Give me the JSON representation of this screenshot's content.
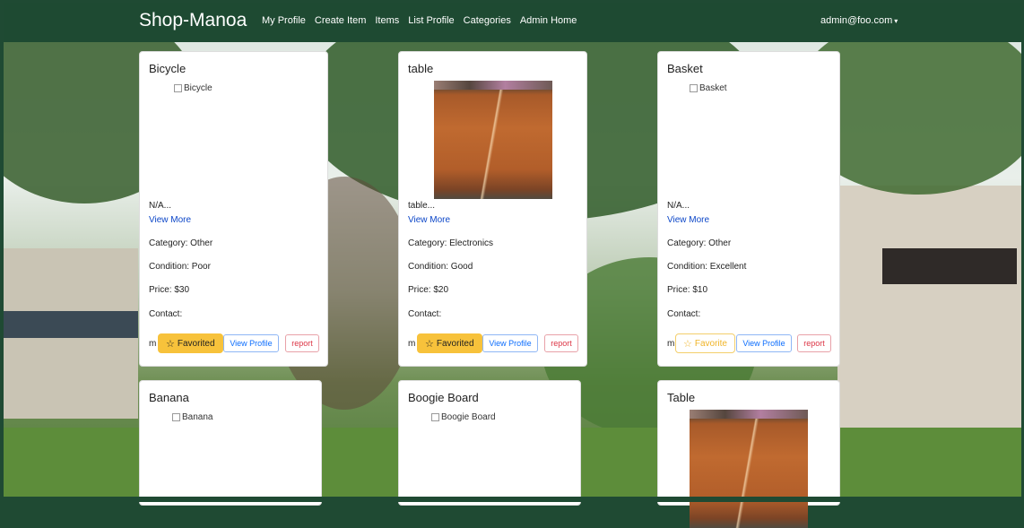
{
  "navbar": {
    "brand": "Shop-Manoa",
    "links": [
      "My Profile",
      "Create Item",
      "Items",
      "List Profile",
      "Categories",
      "Admin Home"
    ],
    "user": "admin@foo.com",
    "user_caret": "▾"
  },
  "colors": {
    "navbar": "#1e4a32",
    "favorite": "#f7c23b",
    "link": "#0d47c8",
    "report": "#dc3545",
    "view_profile": "#0d6efd"
  },
  "cards": [
    {
      "title": "Bicycle",
      "image_alt": "Bicycle",
      "description": "N/A...",
      "view_more": "View More",
      "category": "Category: Other",
      "condition": "Condition: Poor",
      "price": "Price: $30",
      "contact": "Contact:",
      "contact_initial": "m",
      "favorite_label": "Favorited",
      "favorited": true,
      "view_profile": "View Profile",
      "report": "report"
    },
    {
      "title": "table",
      "image_alt": "",
      "description": "table...",
      "view_more": "View More",
      "category": "Category: Electronics",
      "condition": "Condition: Good",
      "price": "Price: $20",
      "contact": "Contact:",
      "contact_initial": "m",
      "favorite_label": "Favorited",
      "favorited": true,
      "view_profile": "View Profile",
      "report": "report"
    },
    {
      "title": "Basket",
      "image_alt": "Basket",
      "description": "N/A...",
      "view_more": "View More",
      "category": "Category: Other",
      "condition": "Condition: Excellent",
      "price": "Price: $10",
      "contact": "Contact:",
      "contact_initial": "m",
      "favorite_label": "Favorite",
      "favorited": false,
      "view_profile": "View Profile",
      "report": "report"
    },
    {
      "title": "Banana",
      "image_alt": "Banana"
    },
    {
      "title": "Boogie Board",
      "image_alt": "Boogie Board"
    },
    {
      "title": "Table",
      "image_alt": ""
    }
  ],
  "icons": {
    "star_filled": "☆",
    "star_outline": "☆"
  }
}
